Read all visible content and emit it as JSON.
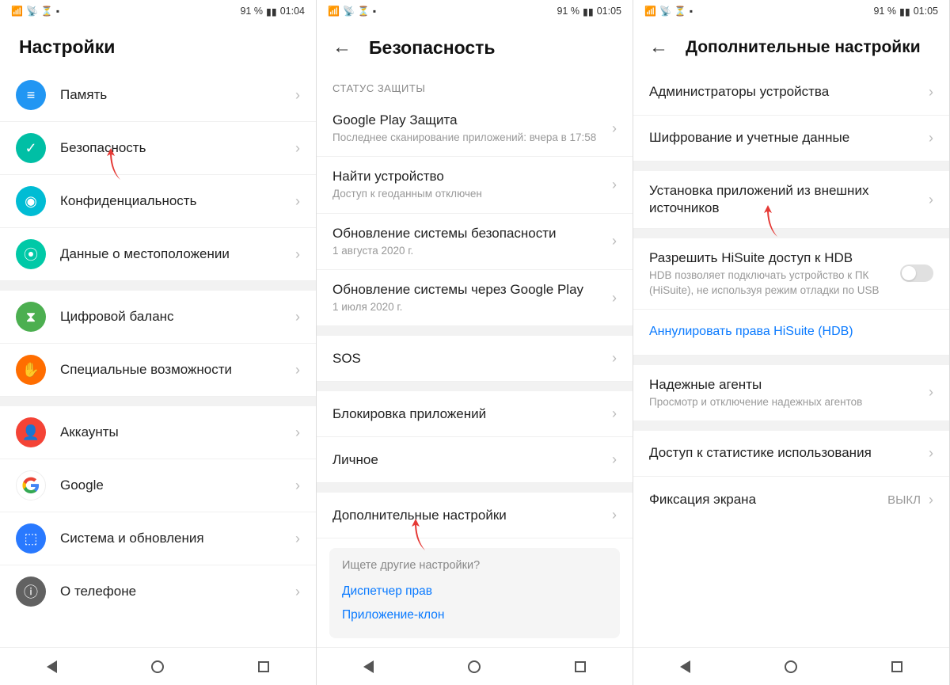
{
  "status": {
    "battery": "91 %",
    "time1": "01:04",
    "time2": "01:05",
    "time3": "01:05"
  },
  "s1": {
    "title": "Настройки",
    "items": [
      {
        "label": "Память"
      },
      {
        "label": "Безопасность"
      },
      {
        "label": "Конфиденциальность"
      },
      {
        "label": "Данные о местоположении"
      },
      {
        "label": "Цифровой баланс"
      },
      {
        "label": "Специальные возможности"
      },
      {
        "label": "Аккаунты"
      },
      {
        "label": "Google"
      },
      {
        "label": "Система и обновления"
      },
      {
        "label": "О телефоне"
      }
    ]
  },
  "s2": {
    "title": "Безопасность",
    "section": "СТАТУС ЗАЩИТЫ",
    "items": [
      {
        "label": "Google Play Защита",
        "sub": "Последнее сканирование приложений: вчера в 17:58"
      },
      {
        "label": "Найти устройство",
        "sub": "Доступ к геоданным отключен"
      },
      {
        "label": "Обновление системы безопасности",
        "sub": "1 августа 2020 г."
      },
      {
        "label": "Обновление системы через Google Play",
        "sub": "1 июля 2020 г."
      }
    ],
    "sos": "SOS",
    "block": "Блокировка приложений",
    "personal": "Личное",
    "more": "Дополнительные настройки",
    "hint_title": "Ищете другие настройки?",
    "hint1": "Диспетчер прав",
    "hint2": "Приложение-клон"
  },
  "s3": {
    "title": "Дополнительные настройки",
    "items": [
      {
        "label": "Администраторы устройства"
      },
      {
        "label": "Шифрование и учетные данные"
      },
      {
        "label": "Установка приложений из внешних источников"
      },
      {
        "label": "Разрешить HiSuite доступ к HDB",
        "sub": "HDB позволяет подключать устройство к ПК (HiSuite), не используя режим отладки по USB"
      },
      {
        "label": "Аннулировать права HiSuite (HDB)"
      },
      {
        "label": "Надежные агенты",
        "sub": "Просмотр и отключение надежных агентов"
      },
      {
        "label": "Доступ к статистике использования"
      },
      {
        "label": "Фиксация экрана",
        "value": "ВЫКЛ"
      }
    ]
  }
}
